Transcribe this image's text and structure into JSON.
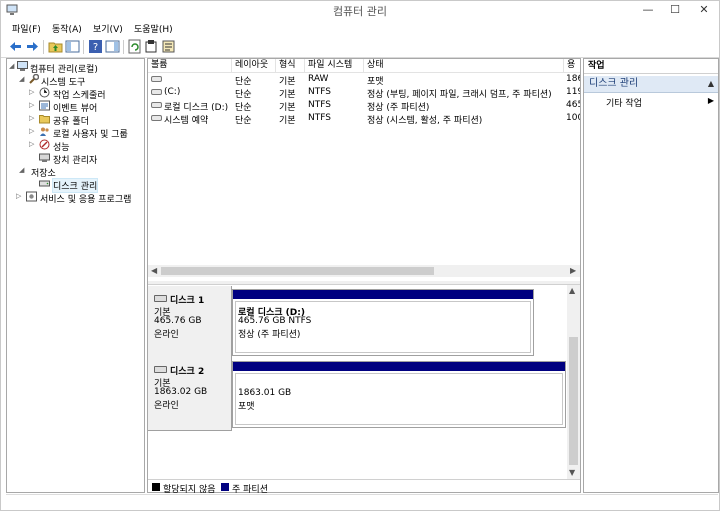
{
  "window": {
    "title": "컴퓨터 관리",
    "min_label": "—",
    "max_label": "☐",
    "close_label": "✕"
  },
  "menu": [
    "파일(F)",
    "동작(A)",
    "보기(V)",
    "도움말(H)"
  ],
  "tree": {
    "root": "컴퓨터 관리(로컬)",
    "system_tools": "시스템 도구",
    "task_scheduler": "작업 스케줄러",
    "event_viewer": "이벤트 뷰어",
    "shared_folders": "공유 폴더",
    "local_users": "로컬 사용자 및 그룹",
    "performance": "성능",
    "device_manager": "장치 관리자",
    "storage": "저장소",
    "disk_management": "디스크 관리",
    "services_apps": "서비스 및 응용 프로그램"
  },
  "volumes": {
    "headers": [
      "볼륨",
      "레이아웃",
      "형식",
      "파일 시스템",
      "상태",
      "용"
    ],
    "rows": [
      {
        "name": "",
        "layout": "단순",
        "type": "기본",
        "fs": "RAW",
        "status": "포맷",
        "cap": "186"
      },
      {
        "name": "(C:)",
        "layout": "단순",
        "type": "기본",
        "fs": "NTFS",
        "status": "정상 (부팅, 페이지 파일, 크래시 덤프, 주 파티션)",
        "cap": "119"
      },
      {
        "name": "로컬 디스크 (D:)",
        "layout": "단순",
        "type": "기본",
        "fs": "NTFS",
        "status": "정상 (주 파티션)",
        "cap": "465"
      },
      {
        "name": "시스템 예약",
        "layout": "단순",
        "type": "기본",
        "fs": "NTFS",
        "status": "정상 (시스템, 활성, 주 파티션)",
        "cap": "100"
      }
    ]
  },
  "disks": [
    {
      "name": "디스크 1",
      "kind": "기본",
      "size": "465.76 GB",
      "state": "온라인",
      "partition": {
        "title": "로컬 디스크  (D:)",
        "line2": "465.76 GB NTFS",
        "line3": "정상 (주 파티션)"
      }
    },
    {
      "name": "디스크 2",
      "kind": "기본",
      "size": "1863.02 GB",
      "state": "온라인",
      "partition": {
        "title": "",
        "line2": "1863.01 GB",
        "line3": "포맷"
      }
    }
  ],
  "legend": {
    "unallocated": "할당되지 않음",
    "primary": "주 파티션",
    "colors": {
      "unallocated": "#000000",
      "primary": "#000080"
    }
  },
  "actions": {
    "header": "작업",
    "section": "디스크 관리",
    "more": "기타 작업"
  }
}
